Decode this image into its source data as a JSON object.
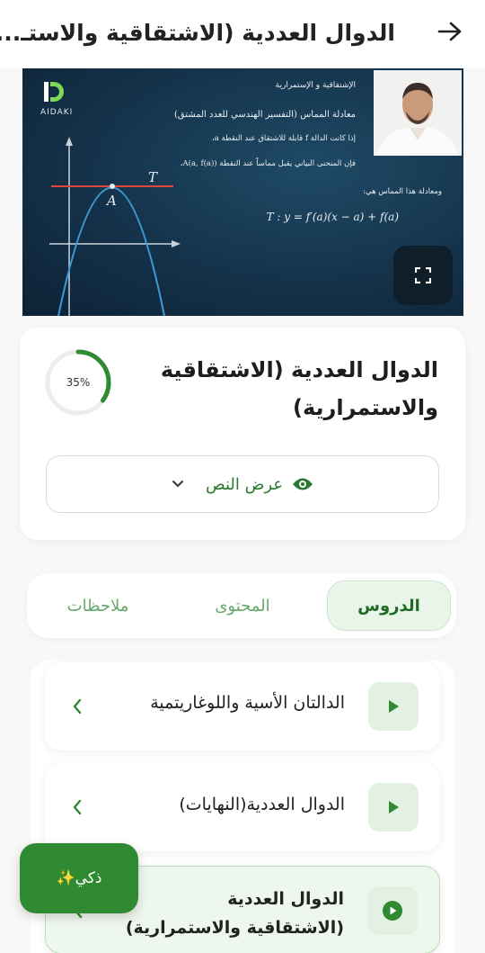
{
  "header": {
    "title": "الدوال العددية (الاشتقاقية والاستـ...",
    "back_icon": "arrow-right-icon"
  },
  "video": {
    "logo_text": "AIDAKI",
    "board_heading": "الإشتقاقية و الإستمرارية",
    "board_line1": "معادلة المماس (التفسير الهندسي للعدد المشتق)",
    "board_line2": "إذا كانت الدالة f قابلة للاشتقاق عند النقطة a،",
    "board_line3": "فإن المنحنى البياني يقبل مماساً عند النقطة A(a, f(a))،",
    "board_line4": "ومعادلة هذا المماس هي:",
    "board_formula": "T :   y = f′(a)(x − a) + f(a)",
    "graph_point_label": "A",
    "graph_tangent_label": "T",
    "fullscreen_icon": "fullscreen-icon"
  },
  "lesson_card": {
    "title": "الدوال العددية (الاشتقاقية والاستمرارية)",
    "progress_label": "35%",
    "progress_value": 0.35,
    "show_text_label": "عرض النص",
    "show_text_icon": "eye-icon",
    "chevron_icon": "chevron-down-icon"
  },
  "tabs": [
    {
      "label": "الدروس",
      "active": true
    },
    {
      "label": "المحتوى",
      "active": false
    },
    {
      "label": "ملاحظات",
      "active": false
    }
  ],
  "lessons": [
    {
      "name": "الدالتان الأسية واللوغاريتمية",
      "current": false
    },
    {
      "name": "الدوال العددية(النهايات)",
      "current": false
    },
    {
      "name_line1": "الدوال العددية",
      "name_line2": "(الاشتقاقية والاستمرارية)",
      "current": true
    }
  ],
  "ai_button": {
    "label": "ذكي✨"
  },
  "colors": {
    "accent": "#2f8a32",
    "accent_light": "#eaf5ea",
    "video_bg": "#14324a"
  }
}
